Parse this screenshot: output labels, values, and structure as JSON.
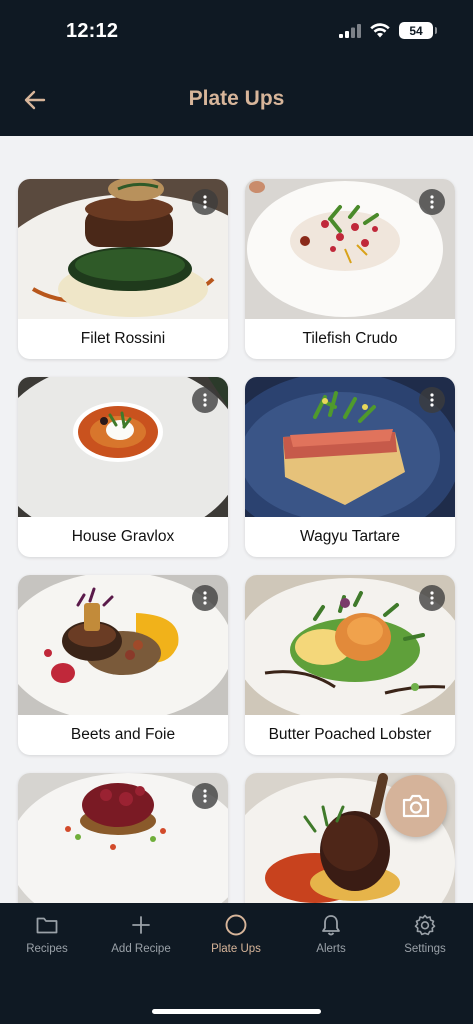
{
  "status_bar": {
    "time": "12:12",
    "battery": "54"
  },
  "header": {
    "title": "Plate Ups",
    "back_icon": "arrow-left-icon"
  },
  "colors": {
    "accent": "#d7b59a",
    "background_dark": "#0f1923",
    "content_bg": "#f1f2f4"
  },
  "plates": [
    {
      "title": "Filet Rossini"
    },
    {
      "title": "Tilefish Crudo"
    },
    {
      "title": "House Gravlox"
    },
    {
      "title": "Wagyu Tartare"
    },
    {
      "title": "Beets and Foie"
    },
    {
      "title": "Butter Poached Lobster"
    },
    {
      "title": ""
    },
    {
      "title": ""
    }
  ],
  "fab": {
    "icon": "camera-icon"
  },
  "tabs": [
    {
      "label": "Recipes",
      "icon": "folder-icon",
      "active": false
    },
    {
      "label": "Add Recipe",
      "icon": "plus-icon",
      "active": false
    },
    {
      "label": "Plate Ups",
      "icon": "circle-icon",
      "active": true
    },
    {
      "label": "Alerts",
      "icon": "bell-icon",
      "active": false
    },
    {
      "label": "Settings",
      "icon": "gear-icon",
      "active": false
    }
  ]
}
